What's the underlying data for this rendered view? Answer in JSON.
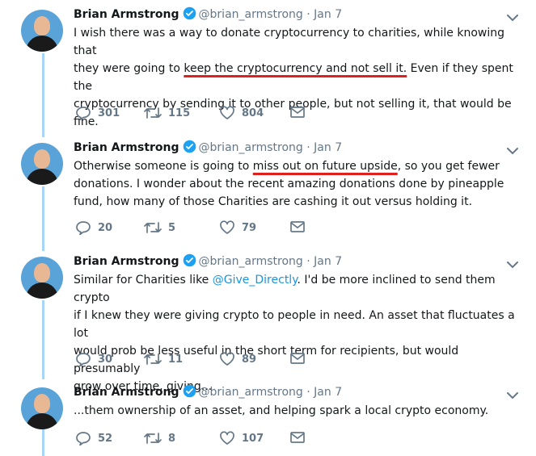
{
  "tweets": [
    {
      "name": "Brian Armstrong",
      "handle": "@brian_armstrong",
      "dot": "·",
      "date": "Jan 7",
      "text_before": "I wish there was a way to donate cryptocurrency to charities, while knowing that\nthey were going to ",
      "text_underlined": "keep the cryptocurrency and not sell it.",
      "text_after": " Even if they spent the\ncryptocurrency by sending it to other people, but not selling it, that would be\nfine.",
      "replies": "301",
      "retweets": "115",
      "likes": "804"
    },
    {
      "name": "Brian Armstrong",
      "handle": "@brian_armstrong",
      "dot": "·",
      "date": "Jan 7",
      "text_before": "Otherwise someone is going to ",
      "text_underlined": "miss out on future upside",
      "text_after": ", so you get fewer\ndonations. I wonder about the recent amazing donations done by pineapple\nfund, how many of those Charities are cashing it out versus holding it.",
      "replies": "20",
      "retweets": "5",
      "likes": "79"
    },
    {
      "name": "Brian Armstrong",
      "handle": "@brian_armstrong",
      "dot": "·",
      "date": "Jan 7",
      "text_before": "Similar for Charities like ",
      "mention": "@Give_Directly",
      "text_after": ". I'd be more inclined to send them crypto\nif I knew they were giving crypto to people in need. An asset that fluctuates a lot\nwould prob be less useful in the short term for recipients, but would presumably\ngrow over time, giving...",
      "replies": "30",
      "retweets": "11",
      "likes": "89"
    },
    {
      "name": "Brian Armstrong",
      "handle": "@brian_armstrong",
      "dot": "·",
      "date": "Jan 7",
      "text_before": "...them ownership of an asset, and helping spark a local crypto economy.",
      "replies": "52",
      "retweets": "8",
      "likes": "107"
    }
  ],
  "icons": {
    "reply": "reply-icon",
    "retweet": "retweet-icon",
    "like": "heart-icon",
    "dm": "envelope-icon",
    "verified": "verified-badge-icon",
    "more": "chevron-down-icon"
  },
  "colors": {
    "accent": "#1da1f2",
    "underline": "#e0201f",
    "thread_line": "#a8d4f5",
    "muted": "#657786"
  }
}
